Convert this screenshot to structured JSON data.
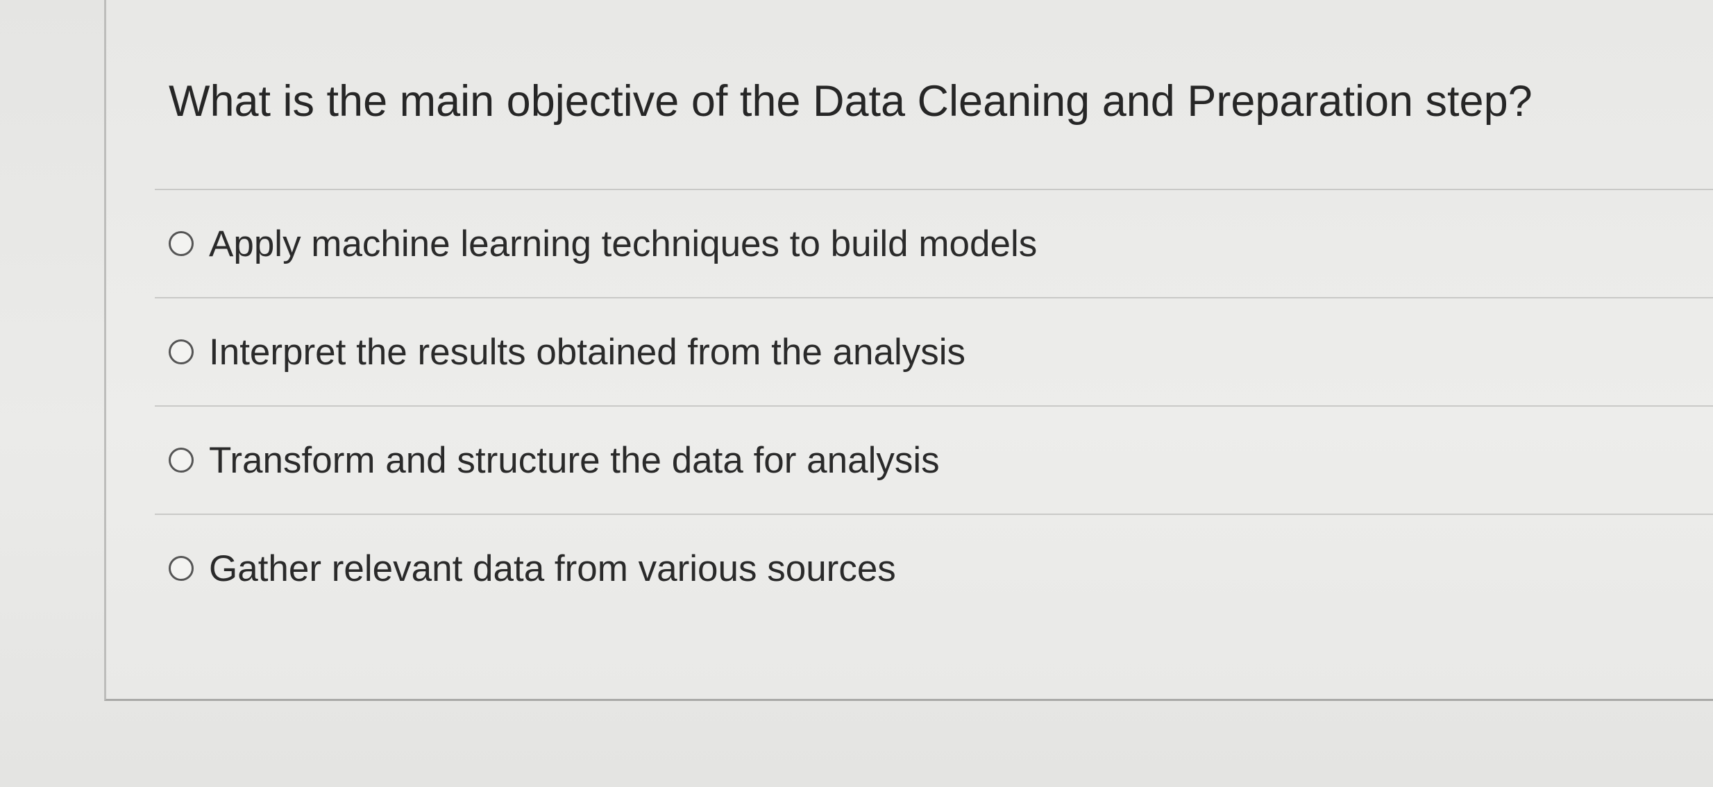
{
  "question": {
    "text": "What is the main objective of the Data Cleaning and Preparation step?"
  },
  "options": [
    {
      "label": "Apply machine learning techniques to build models",
      "selected": false
    },
    {
      "label": "Interpret the results obtained from the analysis",
      "selected": false
    },
    {
      "label": "Transform and structure the data for analysis",
      "selected": false
    },
    {
      "label": "Gather relevant data from various sources",
      "selected": false
    }
  ]
}
